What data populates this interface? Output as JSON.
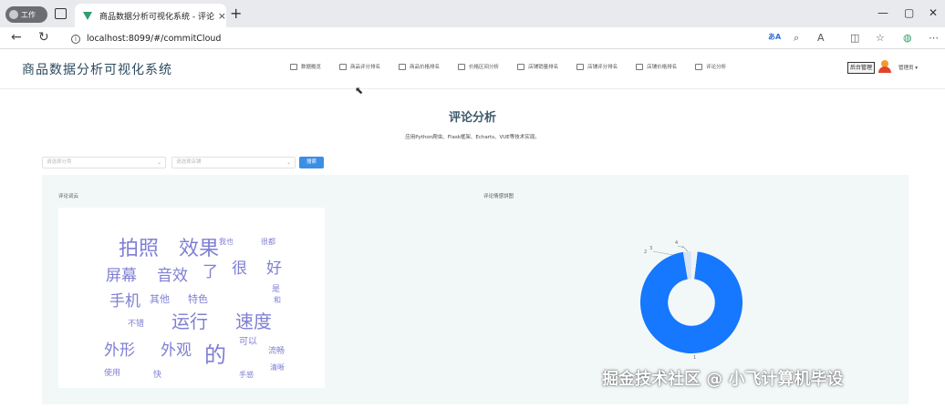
{
  "browser": {
    "profile_label": "工作",
    "tab_title": "商品数据分析可视化系统 - 评论分析",
    "tab_close": "×",
    "new_tab": "+",
    "url": "localhost:8099/#/commitCloud",
    "window_controls": [
      "—",
      "▢",
      "✕"
    ]
  },
  "app": {
    "title": "商品数据分析可视化系统",
    "nav": [
      {
        "label": "数据概览"
      },
      {
        "label": "商品评分排名"
      },
      {
        "label": "商品价格排名"
      },
      {
        "label": "价格区间分析"
      },
      {
        "label": "店铺销量排名"
      },
      {
        "label": "店铺评分排名"
      },
      {
        "label": "店铺价格排名"
      },
      {
        "label": "评论分析"
      }
    ],
    "admin_button": "后台管理",
    "username": "管理员 ▾"
  },
  "page": {
    "title": "评论分析",
    "subtitle": "应用Python爬虫、Flask框架、Echarts、VUE等技术实现。",
    "filter": {
      "select1_placeholder": "请选择分类",
      "select2_placeholder": "请选择店铺",
      "search_label": "搜索"
    },
    "wordcloud_label": "评论词云",
    "pie_label": "评论情感饼图"
  },
  "wordcloud": {
    "color": "#7f7fd4",
    "words": [
      {
        "text": "拍照",
        "size": 22
      },
      {
        "text": "效果",
        "size": 22
      },
      {
        "text": "屏幕",
        "size": 17
      },
      {
        "text": "音效",
        "size": 17
      },
      {
        "text": "了",
        "size": 17
      },
      {
        "text": "很",
        "size": 17
      },
      {
        "text": "好",
        "size": 17
      },
      {
        "text": "手机",
        "size": 17
      },
      {
        "text": "其他",
        "size": 11
      },
      {
        "text": "特色",
        "size": 11
      },
      {
        "text": "运行",
        "size": 20
      },
      {
        "text": "速度",
        "size": 20
      },
      {
        "text": "外形",
        "size": 17
      },
      {
        "text": "外观",
        "size": 17
      },
      {
        "text": "的",
        "size": 24
      },
      {
        "text": "可以",
        "size": 10
      },
      {
        "text": "流畅",
        "size": 9
      },
      {
        "text": "使用",
        "size": 9
      },
      {
        "text": "不错",
        "size": 9
      },
      {
        "text": "我也",
        "size": 8
      },
      {
        "text": "很都",
        "size": 8
      },
      {
        "text": "是",
        "size": 9
      },
      {
        "text": "和",
        "size": 8
      },
      {
        "text": "快",
        "size": 9
      },
      {
        "text": "手感",
        "size": 8
      },
      {
        "text": "清晰",
        "size": 8
      }
    ]
  },
  "chart_data": {
    "type": "pie",
    "title": "",
    "slices": [
      {
        "label": "",
        "value": 95.5,
        "color": "#1677ff"
      },
      {
        "label": "",
        "value": 2.5,
        "color": "#d6e4f5"
      },
      {
        "label": "",
        "value": 2.0,
        "color": "#eef3fa"
      }
    ],
    "tick_labels": [
      "1",
      "2",
      "3",
      "4"
    ],
    "inner_radius_ratio": 0.46
  },
  "watermark": "掘金技术社区 @ 小飞计算机毕设"
}
